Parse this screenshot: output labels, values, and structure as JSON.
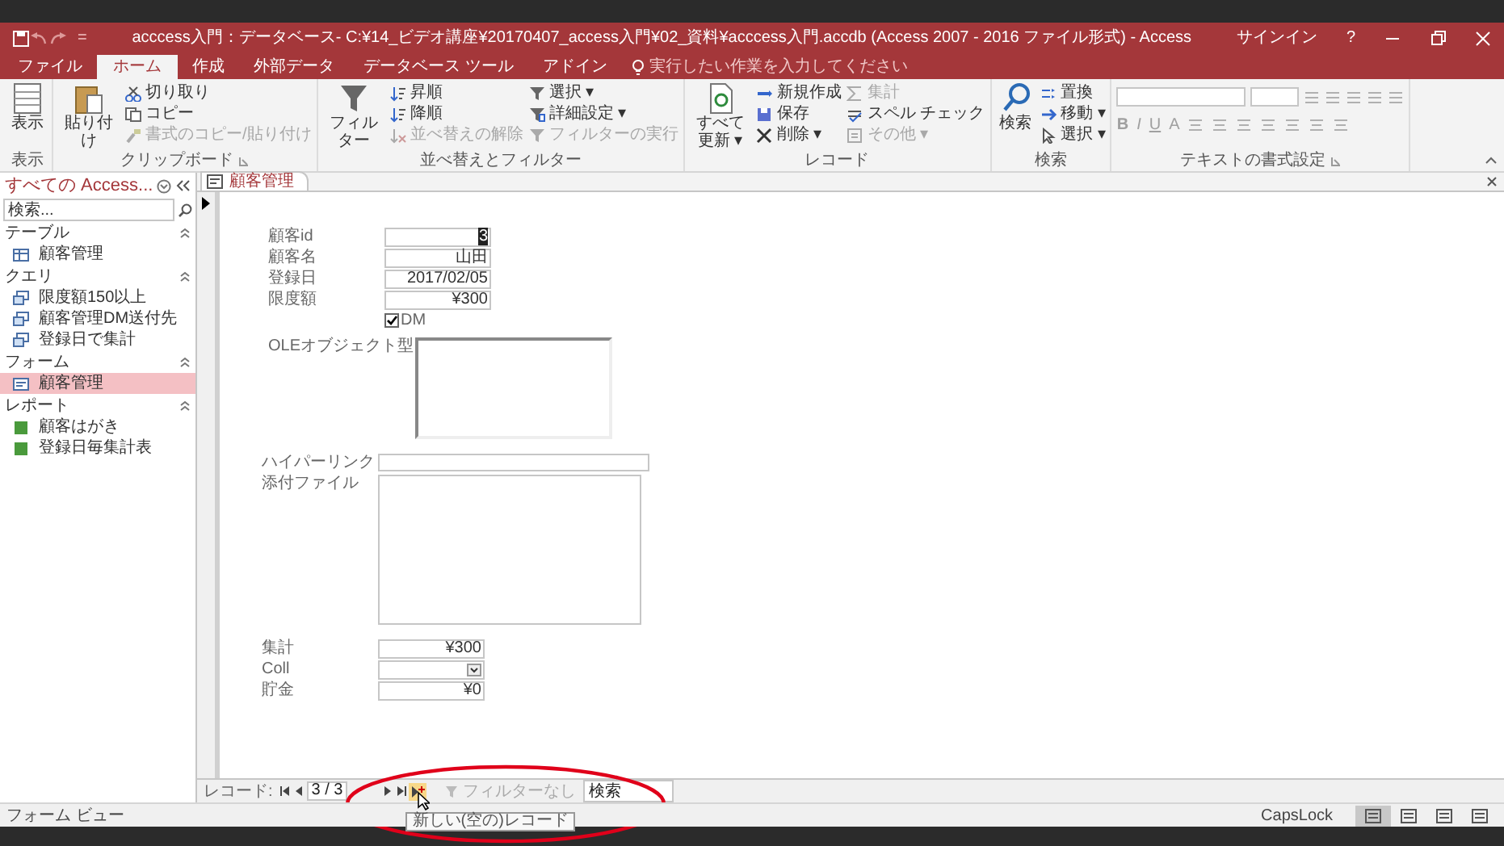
{
  "window": {
    "title": "acccess入門：データベース- C:¥14_ビデオ講座¥20170407_access入門¥02_資料¥acccess入門.accdb (Access 2007 - 2016 ファイル形式) - Access",
    "quick_access": "=",
    "sign_in": "サインイン",
    "help": "?"
  },
  "tabs": [
    {
      "label": "ファイル",
      "selected": false
    },
    {
      "label": "ホーム",
      "selected": true
    },
    {
      "label": "作成",
      "selected": false
    },
    {
      "label": "外部データ",
      "selected": false
    },
    {
      "label": "データベース ツール",
      "selected": false
    },
    {
      "label": "アドイン",
      "selected": false
    }
  ],
  "tell_me": {
    "placeholder": "実行したい作業を入力してください"
  },
  "ribbon": {
    "groups": [
      {
        "label": "表示",
        "launcher": false,
        "columns": [
          [
            {
              "kind": "large",
              "label": "表示",
              "disabled": false
            }
          ]
        ]
      },
      {
        "label": "クリップボード",
        "launcher": true,
        "columns": [
          [
            {
              "kind": "large",
              "label": "貼り付け",
              "disabled": false
            }
          ],
          [
            {
              "kind": "small",
              "label": "切り取り",
              "disabled": false
            },
            {
              "kind": "small",
              "label": "コピー",
              "disabled": false
            },
            {
              "kind": "small",
              "label": "書式のコピー/貼り付け",
              "disabled": true
            }
          ]
        ]
      },
      {
        "label": "並べ替えとフィルター",
        "launcher": false,
        "columns": [
          [
            {
              "kind": "large",
              "label": "フィルター",
              "disabled": false
            }
          ],
          [
            {
              "kind": "small",
              "label": "昇順",
              "disabled": false
            },
            {
              "kind": "small",
              "label": "降順",
              "disabled": false
            },
            {
              "kind": "small",
              "label": "並べ替えの解除",
              "disabled": true
            }
          ],
          [
            {
              "kind": "small",
              "label": "選択 ▾",
              "disabled": false
            },
            {
              "kind": "small",
              "label": "詳細設定 ▾",
              "disabled": false
            },
            {
              "kind": "small",
              "label": "フィルターの実行",
              "disabled": true
            }
          ]
        ]
      },
      {
        "label": "レコード",
        "launcher": false,
        "columns": [
          [
            {
              "kind": "large",
              "label": "すべて更新 ▾",
              "disabled": false
            }
          ],
          [
            {
              "kind": "small",
              "label": "新規作成",
              "disabled": false
            },
            {
              "kind": "small",
              "label": "保存",
              "disabled": false
            },
            {
              "kind": "small",
              "label": "削除 ▾",
              "disabled": false
            }
          ],
          [
            {
              "kind": "small",
              "label": "集計",
              "disabled": true
            },
            {
              "kind": "small",
              "label": "スペル チェック",
              "disabled": false
            },
            {
              "kind": "small",
              "label": "その他 ▾",
              "disabled": true
            }
          ]
        ]
      },
      {
        "label": "検索",
        "launcher": false,
        "columns": [
          [
            {
              "kind": "large",
              "label": "検索",
              "disabled": false
            }
          ],
          [
            {
              "kind": "small",
              "label": "置換",
              "disabled": false
            },
            {
              "kind": "small",
              "label": "移動 ▾",
              "disabled": false
            },
            {
              "kind": "small",
              "label": "選択 ▾",
              "disabled": false
            }
          ]
        ]
      },
      {
        "label": "テキストの書式設定",
        "launcher": true,
        "format_buttons": [
          "B",
          "I",
          "U",
          "A"
        ]
      }
    ]
  },
  "nav": {
    "title": "すべての Access...",
    "search": {
      "placeholder": "検索..."
    },
    "sections": [
      {
        "label": "テーブル",
        "expanded": true,
        "items": [
          {
            "kind": "table",
            "label": "顧客管理",
            "selected": false
          }
        ]
      },
      {
        "label": "クエリ",
        "expanded": true,
        "items": [
          {
            "kind": "query",
            "label": "限度額150以上",
            "selected": false
          },
          {
            "kind": "query",
            "label": "顧客管理DM送付先",
            "selected": false
          },
          {
            "kind": "query",
            "label": "登録日で集計",
            "selected": false
          }
        ]
      },
      {
        "label": "フォーム",
        "expanded": true,
        "items": [
          {
            "kind": "form",
            "label": "顧客管理",
            "selected": true
          }
        ]
      },
      {
        "label": "レポート",
        "expanded": true,
        "items": [
          {
            "kind": "report",
            "label": "顧客はがき",
            "selected": false
          },
          {
            "kind": "report",
            "label": "登録日毎集計表",
            "selected": false
          }
        ]
      }
    ]
  },
  "document_tab": {
    "label": "顧客管理"
  },
  "form": {
    "groups": [
      {
        "fields": [
          {
            "kind": "text",
            "label": "顧客id",
            "value": "3",
            "focused": true
          },
          {
            "kind": "text",
            "label": "顧客名",
            "value": "山田",
            "focused": false
          },
          {
            "kind": "text",
            "label": "登録日",
            "value": "2017/02/05",
            "focused": false
          },
          {
            "kind": "text",
            "label": "限度額",
            "value": "¥300",
            "focused": false
          },
          {
            "kind": "checkbox",
            "label": "DM",
            "checked": true
          },
          {
            "kind": "ole",
            "label": "OLEオブジェクト型"
          }
        ]
      },
      {
        "fields": [
          {
            "kind": "hyperlink",
            "label": "ハイパーリンク"
          },
          {
            "kind": "attachment",
            "label": "添付ファイル"
          }
        ]
      },
      {
        "fields": [
          {
            "kind": "text",
            "label": "集計",
            "value": "¥300",
            "focused": false
          },
          {
            "kind": "combo",
            "label": "Coll"
          },
          {
            "kind": "text",
            "label": "貯金",
            "value": "¥0",
            "focused": false
          }
        ]
      }
    ]
  },
  "record_nav": {
    "label": "レコード:",
    "position": "3 / 3",
    "filter": "フィルターなし",
    "search": {
      "placeholder": "検索"
    },
    "tooltip": "新しい(空の)レコード"
  },
  "status_bar": {
    "view": "フォーム ビュー",
    "caps": "CapsLock",
    "views": [
      {
        "selected": true
      },
      {
        "selected": false
      },
      {
        "selected": false
      },
      {
        "selected": false
      }
    ]
  }
}
